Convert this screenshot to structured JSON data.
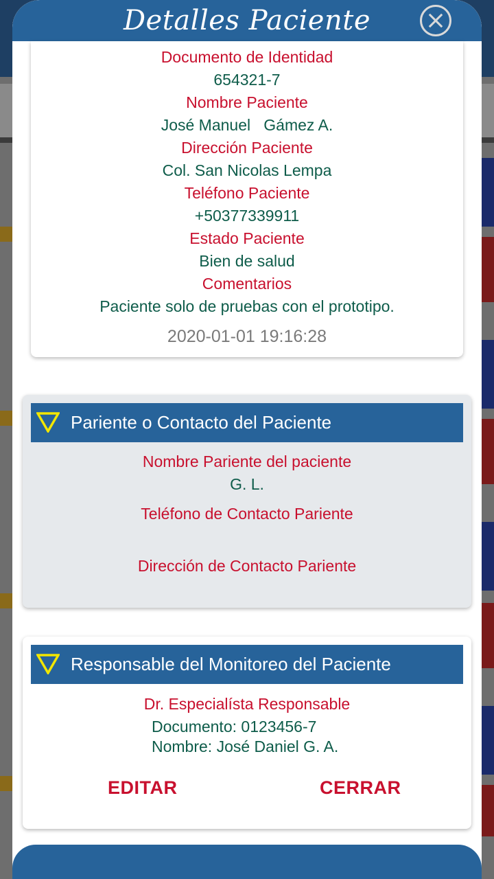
{
  "modal": {
    "title": "Detalles Paciente"
  },
  "patient": {
    "document_label": "Documento de Identidad",
    "document_value": "654321-7",
    "name_label": "Nombre Paciente",
    "name_value": "José Manuel   Gámez A.",
    "address_label": "Dirección Paciente",
    "address_value": "Col. San Nicolas Lempa",
    "phone_label": "Teléfono Paciente",
    "phone_value": "+50377339911",
    "status_label": "Estado Paciente",
    "status_value": "Bien de salud",
    "comments_label": "Comentarios",
    "comments_value": "Paciente solo de pruebas con el prototipo.",
    "timestamp": "2020-01-01 19:16:28"
  },
  "contact": {
    "section_title": "Pariente o Contacto del Paciente",
    "name_label": "Nombre Pariente del paciente",
    "name_value": "G. L.",
    "phone_label": "Teléfono de Contacto Pariente",
    "phone_value": "",
    "address_label": "Dirección de Contacto Pariente",
    "address_value": ""
  },
  "monitor": {
    "section_title": "Responsable del Monitoreo del Paciente",
    "doctor_label": "Dr. Especialísta Responsable",
    "doctor_document": "Documento: 0123456-7",
    "doctor_name": "Nombre: José Daniel G. A."
  },
  "actions": {
    "edit_label": "EDITAR",
    "close_label": "CERRAR"
  },
  "colors": {
    "header_blue": "#27639a",
    "label_red": "#c8102e",
    "value_green": "#0e5c4a",
    "triangle_yellow": "#f2e600"
  },
  "icons": {
    "close": "close-circle-icon",
    "section_toggle": "triangle-down-icon"
  }
}
